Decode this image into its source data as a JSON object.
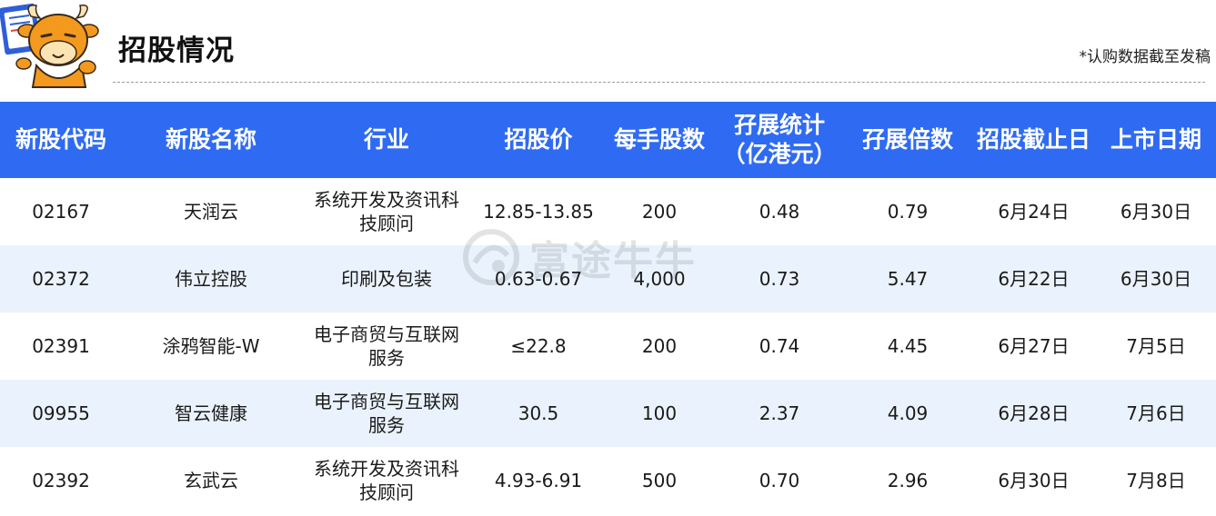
{
  "header": {
    "title": "招股情况",
    "note": "*认购数据截至发稿"
  },
  "watermark": {
    "text": "富途牛牛"
  },
  "table": {
    "columns": [
      {
        "line1": "新股代码",
        "line2": ""
      },
      {
        "line1": "新股名称",
        "line2": ""
      },
      {
        "line1": "行业",
        "line2": ""
      },
      {
        "line1": "招股价",
        "line2": ""
      },
      {
        "line1": "每手股数",
        "line2": ""
      },
      {
        "line1": "孖展统计",
        "line2": "（亿港元）"
      },
      {
        "line1": "孖展倍数",
        "line2": ""
      },
      {
        "line1": "招股截止日",
        "line2": ""
      },
      {
        "line1": "上市日期",
        "line2": ""
      }
    ],
    "rows": [
      {
        "code": "02167",
        "name": "天润云",
        "industry_line1": "系统开发及资讯科",
        "industry_line2": "技顾问",
        "price": "12.85-13.85",
        "lot": "200",
        "margin": "0.48",
        "multiple": "0.79",
        "close_date": "6月24日",
        "list_date": "6月30日"
      },
      {
        "code": "02372",
        "name": "伟立控股",
        "industry_line1": "印刷及包装",
        "industry_line2": "",
        "price": "0.63-0.67",
        "lot": "4,000",
        "margin": "0.73",
        "multiple": "5.47",
        "close_date": "6月22日",
        "list_date": "6月30日"
      },
      {
        "code": "02391",
        "name": "涂鸦智能-W",
        "industry_line1": "电子商贸与互联网",
        "industry_line2": "服务",
        "price": "≤22.8",
        "lot": "200",
        "margin": "0.74",
        "multiple": "4.45",
        "close_date": "6月27日",
        "list_date": "7月5日"
      },
      {
        "code": "09955",
        "name": "智云健康",
        "industry_line1": "电子商贸与互联网",
        "industry_line2": "服务",
        "price": "30.5",
        "lot": "100",
        "margin": "2.37",
        "multiple": "4.09",
        "close_date": "6月28日",
        "list_date": "7月6日"
      },
      {
        "code": "02392",
        "name": "玄武云",
        "industry_line1": "系统开发及资讯科",
        "industry_line2": "技顾问",
        "price": "4.93-6.91",
        "lot": "500",
        "margin": "0.70",
        "multiple": "2.96",
        "close_date": "6月30日",
        "list_date": "7月8日"
      }
    ]
  },
  "colors": {
    "header_bg": "#2f6bf2",
    "row_alt_bg": "#eaf3fd",
    "mascot_orange": "#f39a1e"
  }
}
